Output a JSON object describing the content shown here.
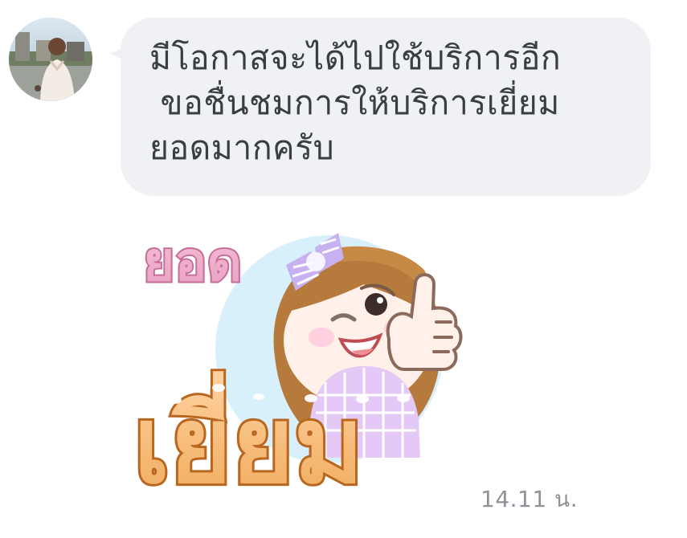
{
  "sender": {
    "avatar_icon": "profile-photo-avatar"
  },
  "message": {
    "text": "มีโอกาสจะได้ไปใช้บริการอีก\n ขอชื่นชมการให้บริการเยี่ยม\nยอดมากครับ",
    "bubble_color": "#eff1f4",
    "text_color": "#3a3d42"
  },
  "sticker": {
    "top_word": "ยอด",
    "bottom_word": "เยี่ยม",
    "top_word_color": "#e9a1c2",
    "bottom_word_color": "#f2b56c"
  },
  "timestamp": "14.11 น."
}
